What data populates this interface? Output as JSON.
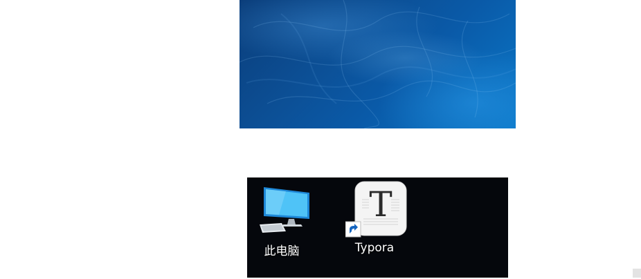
{
  "desktop": {
    "icons": [
      {
        "label": "此电脑",
        "icon": "computer-icon"
      },
      {
        "label": "Typora",
        "icon": "typora-icon",
        "shortcut": true,
        "glyph": "T"
      }
    ]
  },
  "wallpaper": {
    "description_colors": [
      "#0a3d7a",
      "#0c4f95",
      "#0b78c8"
    ]
  }
}
